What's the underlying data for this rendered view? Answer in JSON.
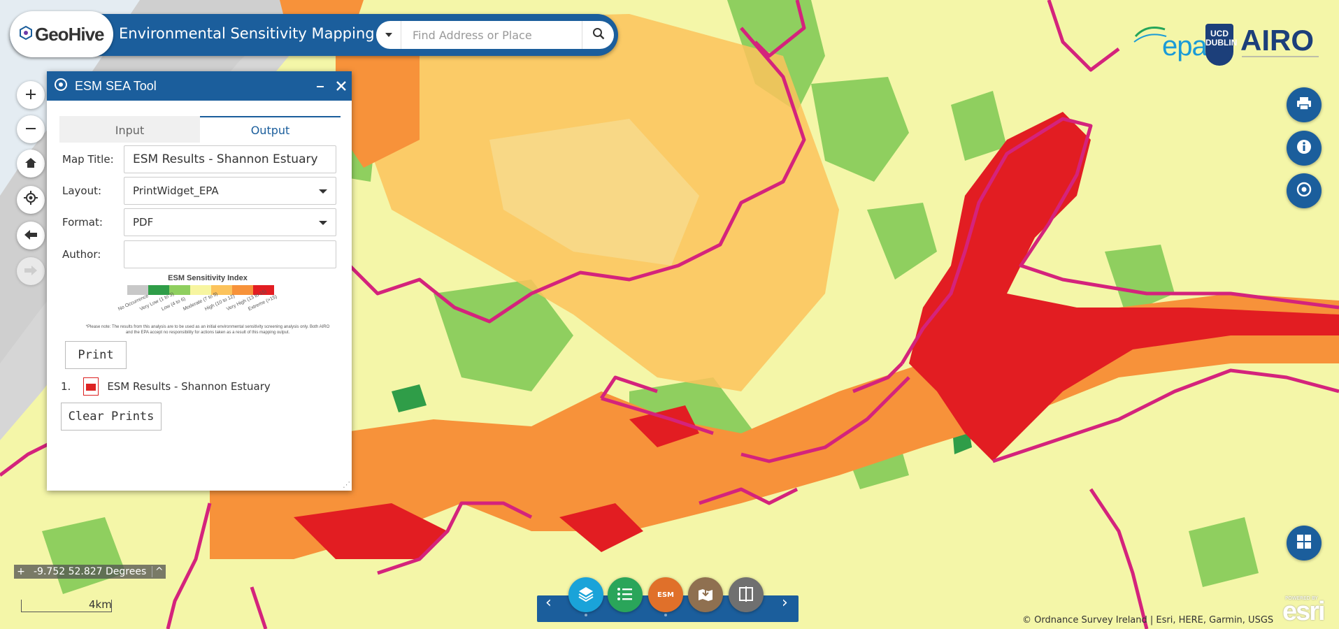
{
  "header": {
    "logo_text": "GeoHive",
    "app_title": "Environmental Sensitivity Mapping",
    "search_placeholder": "Find Address or Place"
  },
  "partners": {
    "epa": "epa",
    "ucd": "UCD DUBLIN",
    "airo": "AIRO"
  },
  "panel": {
    "title": "ESM SEA Tool",
    "tabs": [
      {
        "label": "Input",
        "active": false
      },
      {
        "label": "Output",
        "active": true
      }
    ],
    "fields": {
      "map_title_label": "Map Title:",
      "map_title_value": "ESM Results - Shannon Estuary",
      "layout_label": "Layout:",
      "layout_value": "PrintWidget_EPA",
      "format_label": "Format:",
      "format_value": "PDF",
      "author_label": "Author:",
      "author_value": ""
    },
    "legend": {
      "title": "ESM Sensitivity Index",
      "classes": [
        {
          "label": "No Occurrence",
          "color": "#c8c8c8"
        },
        {
          "label": "Very Low (1 to 3)",
          "color": "#2f9d48"
        },
        {
          "label": "Low (4 to 6)",
          "color": "#8fcf5f"
        },
        {
          "label": "Moderate (7 to 9)",
          "color": "#f7f5a0"
        },
        {
          "label": "High (10 to 12)",
          "color": "#fcc35c"
        },
        {
          "label": "Very High (13 to 15)",
          "color": "#f7923a"
        },
        {
          "label": "Extreme (>15)",
          "color": "#e21d22"
        }
      ],
      "note_line1": "*Please note: The results from this analysis are to be used as an initial environmental sensitivity screening analysis only. Both AIRO",
      "note_line2": "and the EPA accept no responsibility for actions taken as a result of this mapping output."
    },
    "print_button": "Print",
    "prints": [
      {
        "index": "1.",
        "name": "ESM Results - Shannon Estuary"
      }
    ],
    "clear_button": "Clear Prints"
  },
  "map": {
    "coords": "-9.752 52.827 Degrees",
    "scale_label": "4km",
    "attribution": "© Ordnance Survey Ireland | Esri, HERE, Garmin, USGS",
    "esri_powered": "POWERED BY",
    "esri": "esri"
  },
  "widgets": [
    {
      "name": "layers",
      "color": "#1aa3d9"
    },
    {
      "name": "legend",
      "color": "#2aa55a"
    },
    {
      "name": "esm",
      "label": "ESM",
      "color": "#e0702a"
    },
    {
      "name": "data",
      "color": "#8f7050"
    },
    {
      "name": "swipe",
      "color": "#707070"
    }
  ],
  "colors": {
    "brand": "#1b5e9c",
    "moderate": "#f4f6a8",
    "low": "#8fcf5f",
    "very_high": "#f7923a",
    "extreme": "#e21d22",
    "boundary": "#d4237c"
  }
}
